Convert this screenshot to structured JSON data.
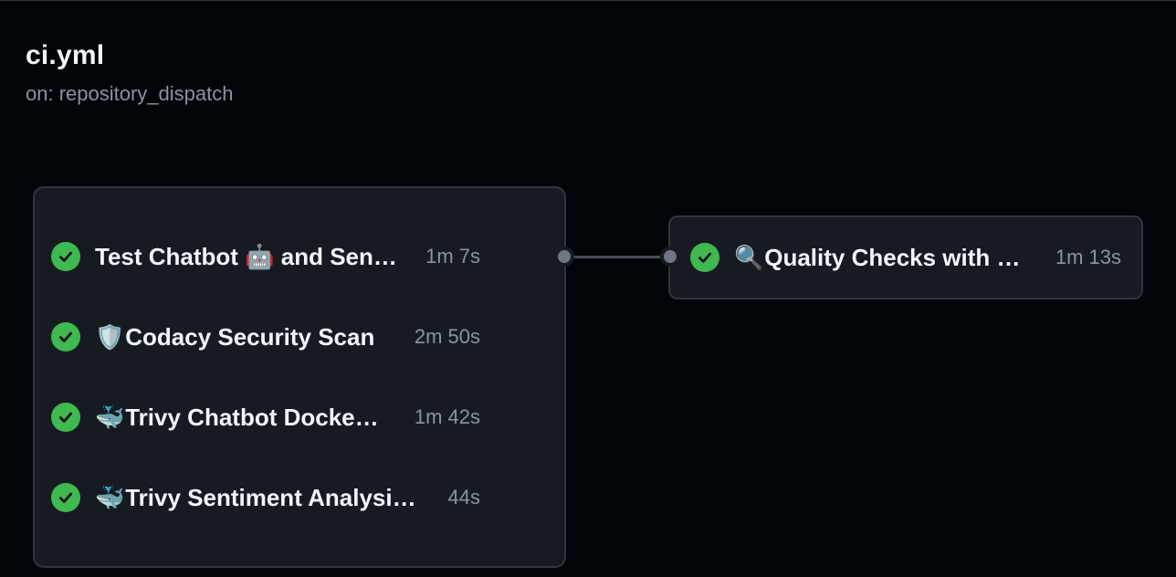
{
  "workflow": {
    "title": "ci.yml",
    "trigger": "on: repository_dispatch"
  },
  "jobs_group": [
    {
      "emoji_before": "",
      "name": "Test Chatbot 🤖 and Sen…",
      "duration": "1m 7s",
      "status": "success",
      "icon": "check-circle-icon"
    },
    {
      "emoji_before": "🛡️",
      "name": "Codacy Security Scan",
      "duration": "2m 50s",
      "status": "success",
      "icon": "check-circle-icon"
    },
    {
      "emoji_before": "🐳",
      "name": "Trivy Chatbot Docke…",
      "duration": "1m 42s",
      "status": "success",
      "icon": "check-circle-icon"
    },
    {
      "emoji_before": "🐳",
      "name": "Trivy Sentiment Analysi…",
      "duration": "44s",
      "status": "success",
      "icon": "check-circle-icon"
    }
  ],
  "downstream_job": {
    "emoji_before": "🔍",
    "name": "Quality Checks with …",
    "duration": "1m 13s",
    "status": "success",
    "icon": "check-circle-icon"
  },
  "colors": {
    "background": "#010409",
    "card": "#161b22",
    "border": "#30363d",
    "success": "#3fb950",
    "muted": "#8b949e"
  }
}
